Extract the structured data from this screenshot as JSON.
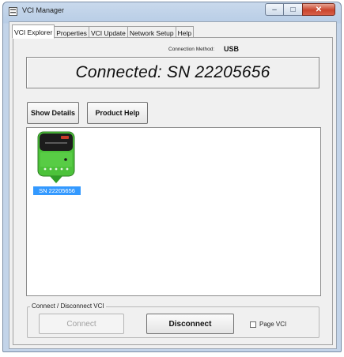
{
  "window": {
    "title": "VCI Manager",
    "controls": {
      "minimize": "–",
      "maximize": "□",
      "close": "✕"
    }
  },
  "tabs": [
    {
      "label": "VCI Explorer",
      "active": true
    },
    {
      "label": "Properties",
      "active": false
    },
    {
      "label": "VCI Update",
      "active": false
    },
    {
      "label": "Network Setup",
      "active": false
    },
    {
      "label": "Help",
      "active": false
    }
  ],
  "connection": {
    "method_label": "Connection Method:",
    "method_value": "USB",
    "status": "Connected: SN 22205656"
  },
  "buttons": {
    "show_details": "Show Details",
    "product_help": "Product Help"
  },
  "devices": [
    {
      "label": "SN 22205656",
      "selected": true,
      "icon": "vci-device-icon"
    }
  ],
  "connect_group": {
    "title": "Connect / Disconnect VCI",
    "connect_label": "Connect",
    "connect_enabled": false,
    "disconnect_label": "Disconnect",
    "page_vci_label": "Page VCI",
    "page_vci_checked": false
  },
  "colors": {
    "selection": "#3399ff",
    "device_body": "#4cc23a",
    "device_top": "#1a1a1a",
    "close_button": "#c9452d"
  }
}
